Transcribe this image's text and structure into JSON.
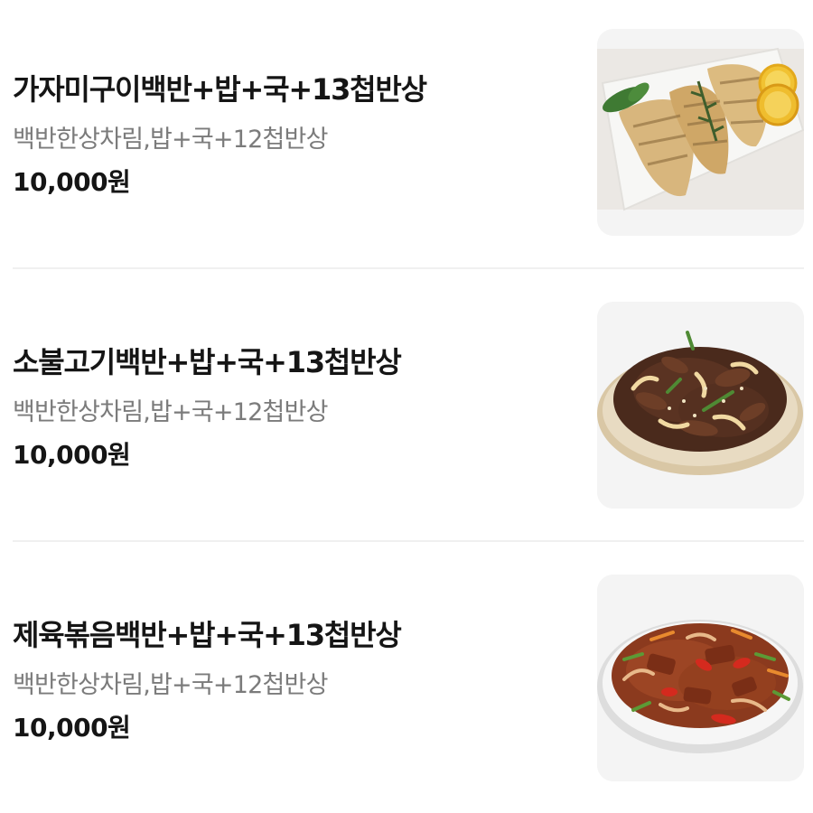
{
  "menu": {
    "items": [
      {
        "name": "가자미구이백반+밥+국+13첩반상",
        "description": "백반한상차림,밥+국+12첩반상",
        "price": "10,000원"
      },
      {
        "name": "소불고기백반+밥+국+13첩반상",
        "description": "백반한상차림,밥+국+12첩반상",
        "price": "10,000원"
      },
      {
        "name": "제육볶음백반+밥+국+13첩반상",
        "description": "백반한상차림,밥+국+12첩반상",
        "price": "10,000원"
      }
    ]
  }
}
